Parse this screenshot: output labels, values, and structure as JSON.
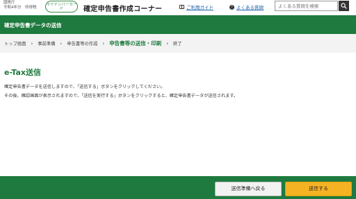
{
  "header": {
    "agency_name": "国税庁",
    "agency_sub": "令和4年分　所得税",
    "mynumber_badge": "マイナンバーカード",
    "corner_title": "確定申告書作成コーナー",
    "guide_link": "ご利用ガイド",
    "faq_link": "よくある質問",
    "search_placeholder": "よくある質問を検索"
  },
  "greenbar": {
    "title": "確定申告書データの送信"
  },
  "breadcrumbs": [
    {
      "label": "トップ画面"
    },
    {
      "label": "事前準備"
    },
    {
      "label": "申告書等の作成"
    },
    {
      "label": "申告書等の送信・印刷"
    },
    {
      "label": "終了"
    }
  ],
  "main": {
    "heading": "e-Tax送信",
    "para1": "確定申告書データを送信しますので、「送信する」ボタンをクリックしてください。",
    "para2": "その後、確認画面が表示されますので、「送信を実行する」ボタンをクリックすると、確定申告書データが送信されます。"
  },
  "footer": {
    "back_label": "送信準備へ戻る",
    "send_label": "送信する"
  },
  "colors": {
    "brand_green": "#1e7a3e",
    "send_button": "#f5b324"
  }
}
